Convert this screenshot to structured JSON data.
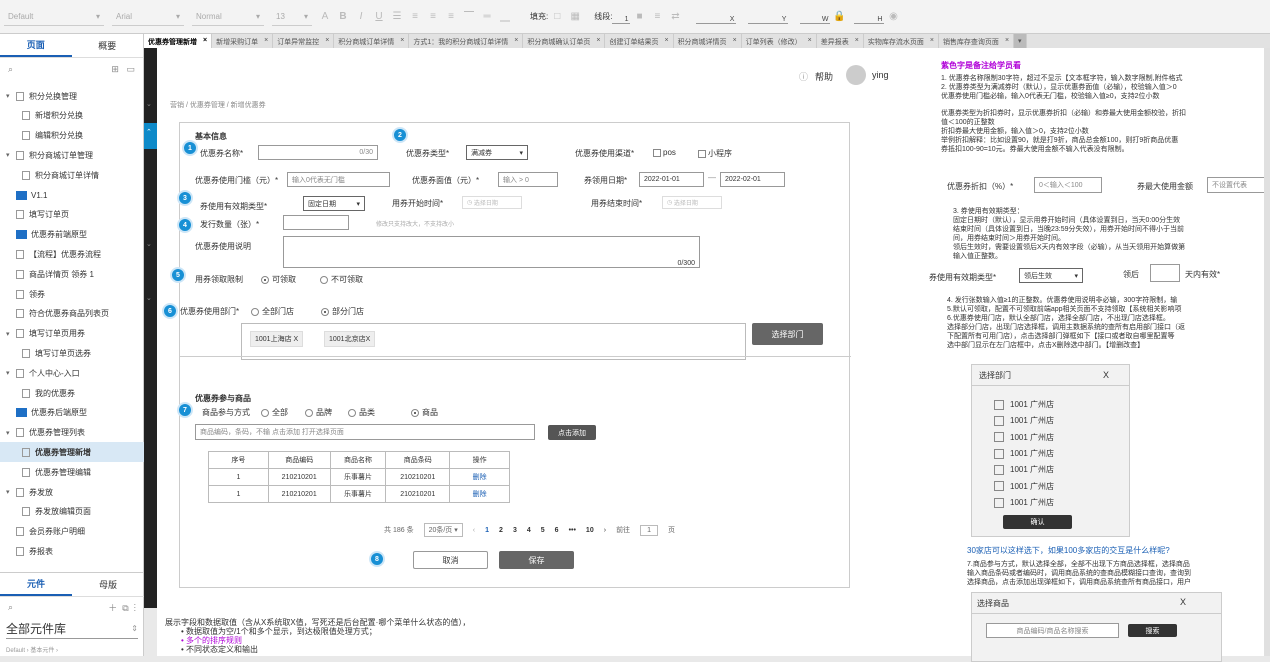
{
  "toolbar": {
    "style_select": "Default",
    "font_select": "Arial",
    "weight_select": "Normal",
    "size_select": "13",
    "fill_label": "填充:",
    "line_label": "线段:",
    "line_value": "1",
    "x_label": "X",
    "y_label": "Y",
    "w_label": "W",
    "h_label": "H"
  },
  "tabs": [
    {
      "label": "优惠券管理新增"
    },
    {
      "label": "新增采购订单"
    },
    {
      "label": "订单异常监控"
    },
    {
      "label": "积分商城订单详情"
    },
    {
      "label": "方式1：我的积分商城订单详情"
    },
    {
      "label": "积分商城确认订单页"
    },
    {
      "label": "创建订单结果页"
    },
    {
      "label": "积分商城详情页"
    },
    {
      "label": "订单列表（修改）"
    },
    {
      "label": "差异报表"
    },
    {
      "label": "实物库存流水页面"
    },
    {
      "label": "销售库存查询页面"
    }
  ],
  "left_panel": {
    "tab_pages": "页面",
    "tab_outline": "概要",
    "pages": [
      {
        "label": "积分兑换管理"
      },
      {
        "label": "新增积分兑换"
      },
      {
        "label": "编辑积分兑换"
      },
      {
        "label": "积分商城订单管理"
      },
      {
        "label": "积分商城订单详情"
      },
      {
        "label": "V1.1"
      },
      {
        "label": "填写订单页"
      },
      {
        "label": "优惠券前端原型"
      },
      {
        "label": "【流程】优惠券流程"
      },
      {
        "label": "商品详情页 领券 1"
      },
      {
        "label": "领券"
      },
      {
        "label": "符合优惠券商品列表页"
      },
      {
        "label": "填写订单页用券"
      },
      {
        "label": "填写订单页选券"
      },
      {
        "label": "个人中心-入口"
      },
      {
        "label": "我的优惠券"
      },
      {
        "label": "优惠券后端原型"
      },
      {
        "label": "优惠券管理列表"
      },
      {
        "label": "优惠券管理新增"
      },
      {
        "label": "优惠券管理编辑"
      },
      {
        "label": "券发放"
      },
      {
        "label": "券发放编辑页面"
      },
      {
        "label": "会员券账户明细"
      },
      {
        "label": "券报表"
      }
    ],
    "tab_widgets": "元件",
    "tab_masters": "母版",
    "library_select": "全部元件库",
    "library_hint": "Default › 基本元件 ›"
  },
  "canvas": {
    "help_label": "帮助",
    "user_name": "ying",
    "breadcrumb": "营销 / 优惠券管理 / 新增优惠券",
    "section_basic": "基本信息",
    "coupon_name_label": "优惠券名称*",
    "coupon_name_count": "0/30",
    "coupon_type_label": "优惠券类型*",
    "coupon_type_value": "满减券",
    "channel_label": "优惠券使用渠道*",
    "channel_pos": "pos",
    "channel_mini": "小程序",
    "threshold_label": "优惠券使用门槛（元）*",
    "threshold_placeholder": "输入0代表无门槛",
    "face_label": "优惠券面值（元）*",
    "face_placeholder": "输入 > 0",
    "claim_date_label": "券领用日期*",
    "claim_start": "2022-01-01",
    "claim_end": "2022-02-01",
    "validity_label": "券使用有效期类型*",
    "validity_value": "固定日期",
    "use_start_label": "用券开始时间*",
    "use_end_label": "用券结束时间*",
    "date_placeholder": "选择日期",
    "issue_qty_label": "发行数量（张）*",
    "issue_qty_hint": "修改只支持改大，不支持改小",
    "desc_label": "优惠券使用说明",
    "desc_count": "0/300",
    "claim_limit_label": "用券领取限制",
    "claim_limit_yes": "可领取",
    "claim_limit_no": "不可领取",
    "dept_label": "优惠券使用部门*",
    "dept_all": "全部门店",
    "dept_part": "部分门店",
    "store_tags": [
      "1001上海店 X",
      "1001北京店X"
    ],
    "select_dept_button": "选择部门",
    "section_goods": "优惠券参与商品",
    "goods_mode_label": "商品参与方式",
    "goods_modes": [
      "全部",
      "品牌",
      "品类",
      "商品"
    ],
    "goods_search_placeholder": "商品编码，条码，不输 点击添加 打开选择页面",
    "add_button": "点击添加",
    "table_headers": [
      "序号",
      "商品编码",
      "商品名称",
      "商品条码",
      "操作"
    ],
    "table_rows": [
      [
        "1",
        "210210201",
        "乐事薯片",
        "210210201",
        "删除"
      ],
      [
        "1",
        "210210201",
        "乐事薯片",
        "210210201",
        "删除"
      ]
    ],
    "pager_total": "共 186 条",
    "pager_size": "20条/页",
    "pager_prev": "‹",
    "pager_pages": [
      "1",
      "2",
      "3",
      "4",
      "5",
      "6",
      "•••",
      "10"
    ],
    "pager_next": "›",
    "pager_goto": "前往",
    "pager_goto_value": "1",
    "pager_goto_unit": "页",
    "cancel_button": "取消",
    "save_button": "保存",
    "badges": [
      "1",
      "2",
      "3",
      "4",
      "5",
      "6",
      "7",
      "8"
    ],
    "bottom_note_title": "展示字段和数据取值（含从X系统取X值，写死还是后台配置·哪个菜单什么状态的值），",
    "bottom_note_1": "• 数据取值为空/1个和多个显示，到达极限值处理方式；",
    "bottom_note_2": "• 多个的排序规则",
    "bottom_note_3": "• 不同状态定义和输出"
  },
  "right_panel": {
    "title": "紫色字是备注给学员看",
    "note1": "1. 优惠券名称限制30字符，超过不显示【文本框字符，输入数字限制,附件格式",
    "note1b": "2. 优惠券类型为满减券时（默认），显示优惠券面值（必输），校验输入值＞0",
    "note1c": "优惠券使用门槛必输，输入0代表无门槛，校验输入值≥0，支持2位小数",
    "note2": "优惠券类型为折扣券时，显示优惠券折扣（必输）和券最大使用金额校验，折扣",
    "note2b": "值＜100的正整数",
    "note2c": "折扣券最大使用金额，输入值＞0，支持2位小数",
    "note2d": "举例折扣解释：比如设置90，就是打9折，商品总金额100，则打9折商品优惠",
    "note2e": "券抵扣100-90=10元。券最大使用金额不输入代表没有限制。",
    "discount_label": "优惠券折扣（%）*",
    "discount_placeholder": "0＜输入＜100",
    "max_amount_label": "券最大使用金额",
    "max_amount_placeholder": "不设置代表",
    "note3": "3. 券使用有效期类型：",
    "note3b": "固定日期时（默认），显示用券开始时间（具体设置到日，当天0:00分生效",
    "note3c": "结束时间（具体设置到日，当晚23:59分失效），用券开始时间不得小于当前",
    "note3d": "间，用券结束时间＞用券开始时间。",
    "note3e": "领后生效时，需要设置领后X天内有效字段（必输），从当天领用开始算做第",
    "note3f": "输入值正整数。",
    "validity_label": "券使用有效期类型*",
    "validity_value": "领后生效",
    "after_label": "领后",
    "days_label": "天内有效*",
    "note4": "4. 发行张数输入值≥1的正整数。优惠券使用说明非必输，300字符限制，输",
    "note5": "5.默认可领取，配置不可领取前端app相关页面不支持领取【系统相关影响项",
    "note6": "6.优惠券使用门店，默认全部门店，选择全部门店，不出现门店选择框。",
    "note6b": "选择部分门店，出现门店选择框，调用主数据系统的查所有启用部门接口（返",
    "note6c": "下配置所有可用门店），点击选择部门弹框如下【接口或者取自哪里配置等",
    "note6d": "选中部门显示在左门店框中，点击X删除选中部门。【增删改查】",
    "dept_dialog_title": "选择部门",
    "dept_dialog_close": "X",
    "dept_items": [
      "1001 广州店",
      "1001 广州店",
      "1001 广州店",
      "1001 广州店",
      "1001 广州店",
      "1001 广州店",
      "1001 广州店"
    ],
    "confirm_button": "确认",
    "question": "30家店可以这样选下，如果100多家店的交互是什么样呢?",
    "note7": "7.商品参与方式，默认选择全部，全部不出现下方商品选择框，选择商品",
    "note7b": "输入商品条码或者编码时，调用商品系统的查商品模糊接口查询，查询到",
    "note7c": "选择商品，点击添加出现弹框如下，调用商品系统查所有商品接口，用户",
    "goods_dialog_title": "选择商品",
    "goods_dialog_close": "X",
    "goods_search_placeholder": "商品编码/商品名称搜索",
    "search_button": "搜索"
  },
  "colors": {
    "accent": "#1a5fb4",
    "badge": "#1890d5",
    "purple": "#b000d8",
    "blue_link": "#1a5fb4",
    "dark_button": "#555555"
  }
}
